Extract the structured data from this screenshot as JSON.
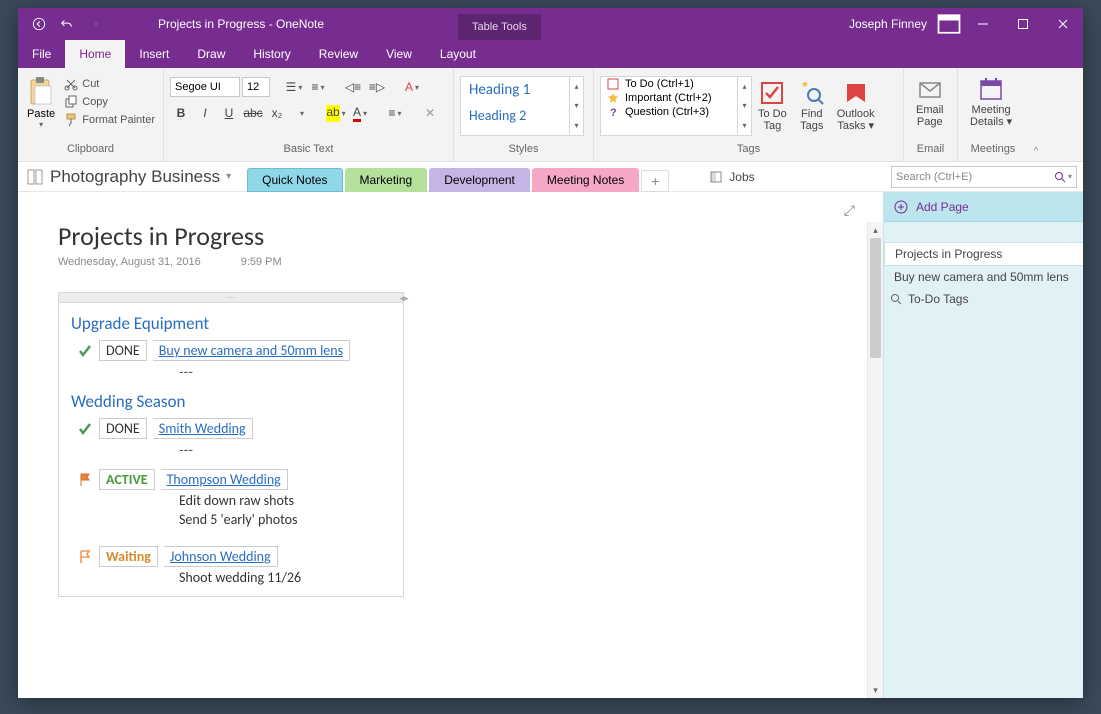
{
  "titlebar": {
    "doc_title": "Projects in Progress  -  OneNote",
    "contextual_label": "Table Tools",
    "username": "Joseph Finney"
  },
  "tabs": {
    "file": "File",
    "home": "Home",
    "insert": "Insert",
    "draw": "Draw",
    "history": "History",
    "review": "Review",
    "view": "View",
    "layout": "Layout"
  },
  "ribbon": {
    "clipboard": {
      "paste": "Paste",
      "cut": "Cut",
      "copy": "Copy",
      "format_painter": "Format Painter",
      "label": "Clipboard"
    },
    "basic_text": {
      "font_name": "Segoe UI",
      "font_size": "12",
      "label": "Basic Text"
    },
    "styles": {
      "heading1": "Heading 1",
      "heading2": "Heading 2",
      "label": "Styles"
    },
    "tags": {
      "todo": "To Do (Ctrl+1)",
      "important": "Important (Ctrl+2)",
      "question": "Question (Ctrl+3)",
      "todo_tag": "To Do\nTag",
      "find_tags": "Find\nTags",
      "outlook_tasks": "Outlook\nTasks",
      "label": "Tags"
    },
    "email": {
      "email_page": "Email\nPage",
      "label": "Email"
    },
    "meetings": {
      "meeting_details": "Meeting\nDetails",
      "label": "Meetings"
    }
  },
  "notebook": {
    "name": "Photography Business",
    "sections": {
      "quick_notes": "Quick Notes",
      "marketing": "Marketing",
      "development": "Development",
      "meeting_notes": "Meeting Notes"
    },
    "jobs": "Jobs",
    "search_placeholder": "Search (Ctrl+E)"
  },
  "page": {
    "title": "Projects in Progress",
    "date": "Wednesday, August 31, 2016",
    "time": "9:59 PM",
    "sections": [
      {
        "heading": "Upgrade Equipment",
        "tasks": [
          {
            "flag": "check",
            "status": "DONE",
            "status_class": "done",
            "link": "Buy new camera and 50mm lens",
            "sub": []
          }
        ],
        "dashes": "---"
      },
      {
        "heading": "Wedding Season",
        "tasks": [
          {
            "flag": "check",
            "status": "DONE",
            "status_class": "done",
            "link": "Smith Wedding",
            "sub": []
          },
          {
            "dashes": "---"
          },
          {
            "flag": "flag",
            "status": "ACTIVE",
            "status_class": "active",
            "link": "Thompson Wedding",
            "sub": [
              "Edit down raw shots",
              "Send 5 'early' photos"
            ]
          },
          {
            "spacer": true
          },
          {
            "flag": "flag-outline",
            "status": "Waiting",
            "status_class": "waiting",
            "link": "Johnson Wedding",
            "sub": [
              "Shoot wedding 11/26"
            ]
          }
        ]
      }
    ]
  },
  "page_panel": {
    "add_page": "Add Page",
    "pages": [
      {
        "title": "Projects in Progress",
        "active": true
      },
      {
        "title": "Buy new camera and 50mm lens",
        "active": false
      },
      {
        "title": "To-Do Tags",
        "active": false,
        "tagged": true
      }
    ]
  }
}
